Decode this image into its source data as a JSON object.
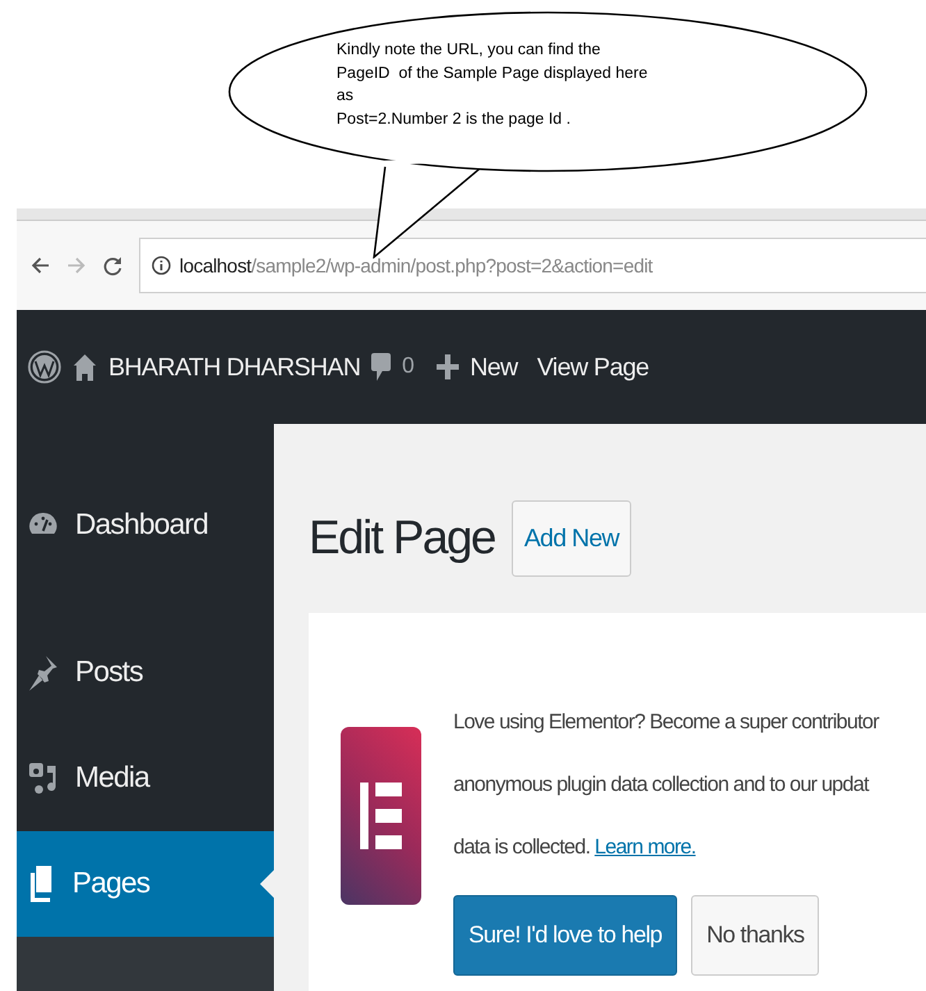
{
  "callout": {
    "lines": [
      "Kindly note the URL, you can find the",
      "PageID  of the Sample Page displayed here",
      "as",
      "Post=2.Number 2 is the page Id ."
    ]
  },
  "browser": {
    "url_host": "localhost",
    "url_path": "/sample2/wp-admin/post.php?post=2&action=edit"
  },
  "admin_bar": {
    "site_name": "BHARATH DHARSHAN",
    "comments_count": "0",
    "new_label": "New",
    "view_label": "View Page"
  },
  "sidebar": {
    "items": [
      {
        "label": "Dashboard",
        "selected": false
      },
      {
        "label": "Posts",
        "selected": false
      },
      {
        "label": "Media",
        "selected": false
      },
      {
        "label": "Pages",
        "selected": true
      }
    ]
  },
  "heading": "Edit Page",
  "add_new": "Add New",
  "notice": {
    "lines": [
      "Love using Elementor? Become a super contributor",
      "anonymous plugin data collection and to our updat",
      "data is collected."
    ],
    "link": "Learn more.",
    "buttons": [
      {
        "label": "Sure! I'd love to help",
        "kind": "primary"
      },
      {
        "label": "No thanks",
        "kind": "secondary"
      }
    ]
  }
}
